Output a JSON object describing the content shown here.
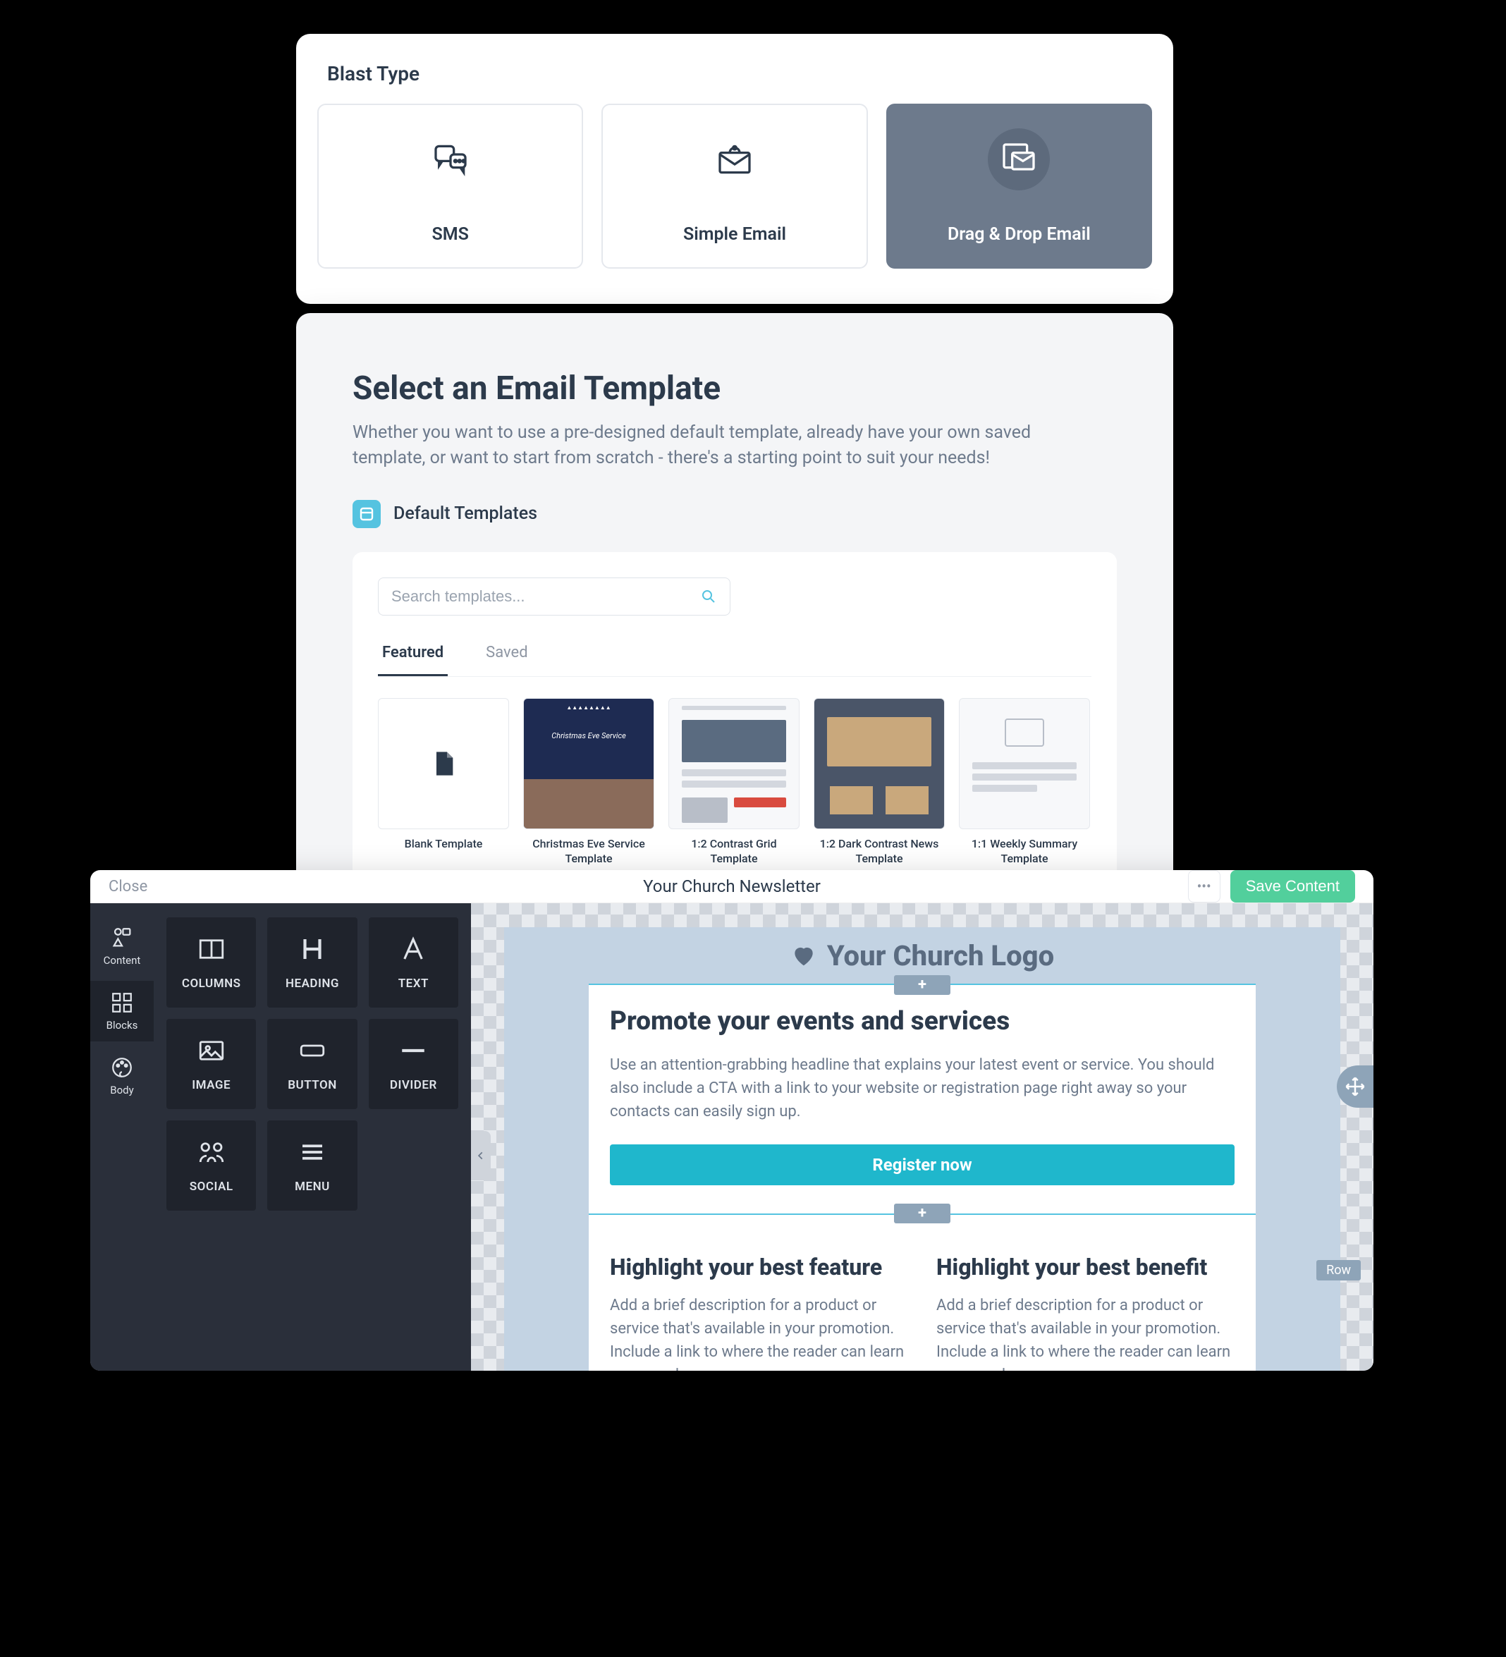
{
  "blast": {
    "title": "Blast Type",
    "options": [
      {
        "label": "SMS"
      },
      {
        "label": "Simple Email"
      },
      {
        "label": "Drag & Drop Email"
      }
    ],
    "selected_index": 2
  },
  "select": {
    "heading": "Select an Email Template",
    "subheading": "Whether you want to use a pre-designed default template, already have your own saved template, or want to start from scratch - there's a starting point to suit your needs!",
    "default_label": "Default Templates",
    "search_placeholder": "Search templates...",
    "tabs": [
      "Featured",
      "Saved"
    ],
    "active_tab": 0,
    "templates": [
      {
        "name": "Blank Template"
      },
      {
        "name": "Christmas Eve Service Template"
      },
      {
        "name": "1:2 Contrast Grid Template"
      },
      {
        "name": "1:2 Dark Contrast News Template"
      },
      {
        "name": "1:1 Weekly Summary Template"
      }
    ]
  },
  "editor": {
    "close": "Close",
    "title": "Your Church Newsletter",
    "save": "Save Content",
    "side": [
      {
        "label": "Content"
      },
      {
        "label": "Blocks"
      },
      {
        "label": "Body"
      }
    ],
    "active_side": 1,
    "tools": [
      {
        "label": "COLUMNS"
      },
      {
        "label": "HEADING"
      },
      {
        "label": "TEXT"
      },
      {
        "label": "IMAGE"
      },
      {
        "label": "BUTTON"
      },
      {
        "label": "DIVIDER"
      },
      {
        "label": "SOCIAL"
      },
      {
        "label": "MENU"
      }
    ],
    "row_badge": "Row",
    "email": {
      "logo": "Your Church Logo",
      "promo_heading": "Promote your events and services",
      "promo_text": "Use an attention-grabbing headline that explains your latest event or service. You should also include a CTA with a link to your website or registration page right away so your contacts can easily sign up.",
      "cta": "Register now",
      "col1_heading": "Highlight your best feature",
      "col1_text": "Add a brief description for a product or service that's available in your promotion. Include a link to where the reader can learn more or shop.",
      "col2_heading": "Highlight your best benefit",
      "col2_text": "Add a brief description for a product or service that's available in your promotion. Include a link to where the reader can learn more or shop."
    }
  }
}
